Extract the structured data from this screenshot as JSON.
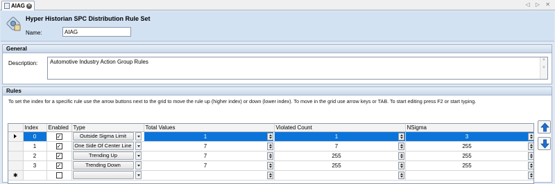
{
  "tab": {
    "label": "AIAG",
    "close_icon": "close-icon",
    "nav": "◁ ▷ ✕"
  },
  "header": {
    "title": "Hyper Historian SPC Distribution Rule Set",
    "name_label": "Name:",
    "name_value": "AIAG"
  },
  "general": {
    "title": "General",
    "description_label": "Description:",
    "description_value": "Automotive Industry Action Group Rules"
  },
  "rules": {
    "title": "Rules",
    "hint": "To set the index for a specific rule use the arrow buttons next to the grid to move the rule up (higher index) or down (lower index).  To move in the grid use arrow keys or TAB. To start editing press F2 or start typing.",
    "columns": [
      "Index",
      "Enabled",
      "Type",
      "Total Values",
      "Violated Count",
      "NSigma"
    ],
    "rows": [
      {
        "index": "0",
        "enabled": true,
        "type": "Outside Sigma Limit",
        "total": "1",
        "violated": "1",
        "nsigma": "3"
      },
      {
        "index": "1",
        "enabled": true,
        "type": "One Side Of Center Line",
        "total": "7",
        "violated": "7",
        "nsigma": "255"
      },
      {
        "index": "2",
        "enabled": true,
        "type": "Trending Up",
        "total": "7",
        "violated": "255",
        "nsigma": "255"
      },
      {
        "index": "3",
        "enabled": true,
        "type": "Trending Down",
        "total": "7",
        "violated": "255",
        "nsigma": "255"
      }
    ],
    "new_row_marker": "✱",
    "move_up_icon": "arrow-up-icon",
    "move_down_icon": "arrow-down-icon"
  },
  "colors": {
    "accent": "#0a74da",
    "header_bg": "#d3e2f3"
  }
}
